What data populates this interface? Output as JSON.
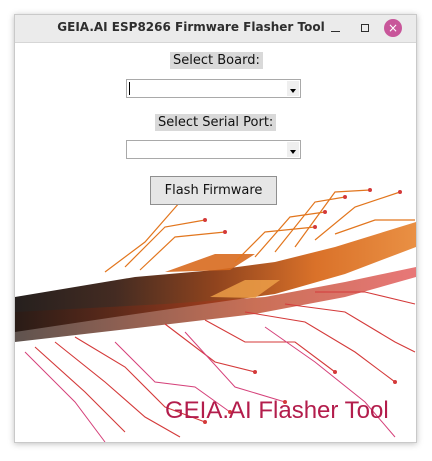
{
  "window": {
    "title": "GEIA.AI ESP8266 Firmware Flasher Tool",
    "close_glyph": "×"
  },
  "form": {
    "board_label": "Select Board:",
    "board_value": "",
    "port_label": "Select Serial Port:",
    "port_value": "",
    "flash_button": "Flash Firmware"
  },
  "background": {
    "brand_text": "GEIA.AI Flasher Tool",
    "colors": {
      "trace_dark": "#2b1810",
      "trace_orange": "#e2761e",
      "trace_red": "#d43a3a",
      "trace_pink": "#d5417a",
      "brand": "#b31d4c"
    }
  },
  "icons": {
    "minimize": "minimize-icon",
    "maximize": "maximize-icon",
    "close": "close-icon",
    "dropdown": "chevron-down-icon"
  }
}
